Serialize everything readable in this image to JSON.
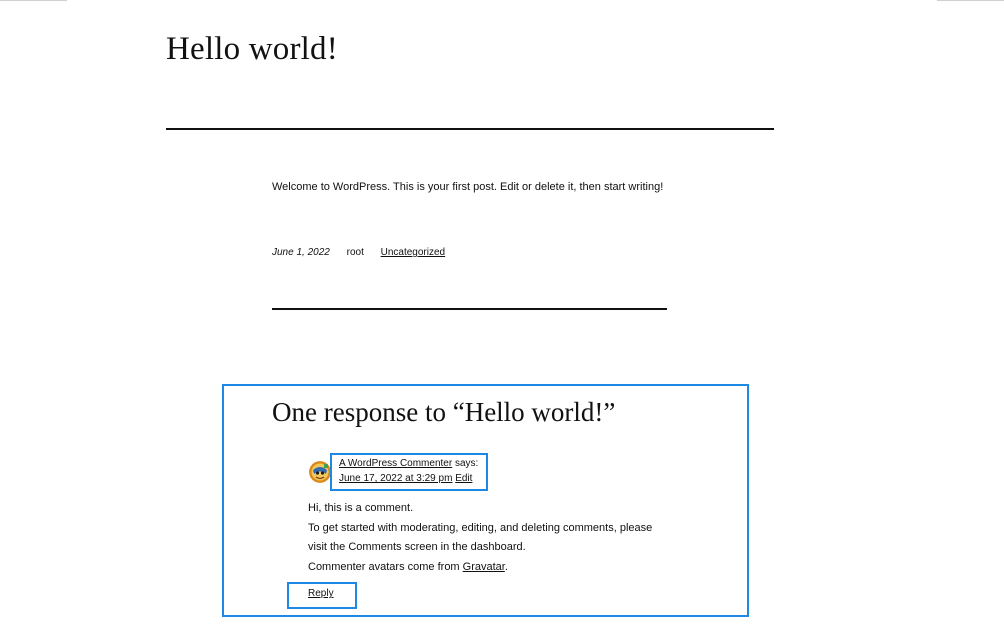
{
  "post": {
    "title": "Hello world!",
    "body": "Welcome to WordPress. This is your first post. Edit or delete it, then start writing!",
    "meta": {
      "date": "June 1, 2022",
      "author": "root",
      "category": "Uncategorized"
    }
  },
  "comments": {
    "heading": "One response to “Hello world!”",
    "items": [
      {
        "author": "A WordPress Commenter",
        "says": " says:",
        "date_link": "June 17, 2022 at 3:29 pm",
        "edit_label": "Edit",
        "avatar_icon": "gravatar-avatar-icon",
        "lines": [
          "Hi, this is a comment.",
          "To get started with moderating, editing, and deleting comments, please",
          "visit the Comments screen in the dashboard."
        ],
        "last_line_prefix": "Commenter avatars come from ",
        "last_line_link": "Gravatar",
        "last_line_suffix": ".",
        "reply_label": "Reply"
      }
    ]
  },
  "colors": {
    "highlight": "#1e88e5",
    "text": "#111111"
  }
}
